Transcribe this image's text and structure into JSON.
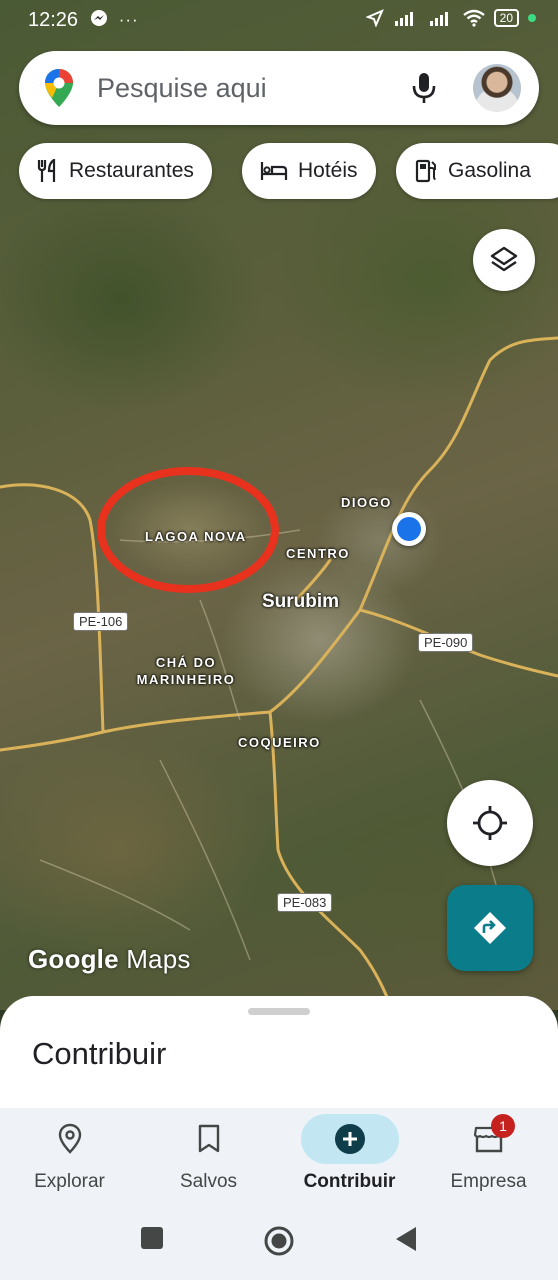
{
  "status_bar": {
    "time": "12:26",
    "left_icons": "⊙ ···",
    "battery": "20",
    "signal": "📶"
  },
  "search": {
    "placeholder": "Pesquise aqui"
  },
  "chips": [
    {
      "label": "Restaurantes",
      "icon": "fork-knife-icon"
    },
    {
      "label": "Hotéis",
      "icon": "bed-icon"
    },
    {
      "label": "Gasolina",
      "icon": "fuel-pump-icon"
    }
  ],
  "map": {
    "places": {
      "lagoa_nova": "LAGOA NOVA",
      "diogo": "DIOGO",
      "centro": "CENTRO",
      "surubim": "Surubim",
      "cha_do_marinheiro_1": "CHÁ DO",
      "cha_do_marinheiro_2": "MARINHEIRO",
      "coqueiro": "COQUEIRO"
    },
    "roads": {
      "pe106": "PE-106",
      "pe090": "PE-090",
      "pe083": "PE-083"
    },
    "annotation_color": "#e8321e",
    "logo_google": "Google",
    "logo_maps": "Maps"
  },
  "sheet": {
    "title": "Contribuir"
  },
  "nav": {
    "items": [
      {
        "label": "Explorar",
        "icon": "location-pin-icon",
        "active": false
      },
      {
        "label": "Salvos",
        "icon": "bookmark-icon",
        "active": false
      },
      {
        "label": "Contribuir",
        "icon": "add-circle-icon",
        "active": true
      },
      {
        "label": "Empresa",
        "icon": "storefront-icon",
        "active": false,
        "badge": "1"
      }
    ]
  },
  "colors": {
    "accent": "#0b7c8a",
    "active_nav_bg": "#c2e7f2",
    "location_dot": "#1a73e8",
    "badge": "#c5221f"
  }
}
